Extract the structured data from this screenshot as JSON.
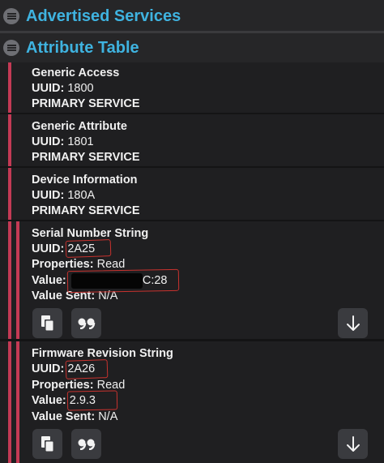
{
  "sections": {
    "advertised": "Advertised Services",
    "attribute_table": "Attribute Table"
  },
  "services": [
    {
      "name": "Generic Access",
      "uuid_label": "UUID:",
      "uuid": "1800",
      "type": "PRIMARY SERVICE"
    },
    {
      "name": "Generic Attribute",
      "uuid_label": "UUID:",
      "uuid": "1801",
      "type": "PRIMARY SERVICE"
    },
    {
      "name": "Device Information",
      "uuid_label": "UUID:",
      "uuid": "180A",
      "type": "PRIMARY SERVICE"
    }
  ],
  "characteristics": [
    {
      "name": "Serial Number String",
      "uuid_label": "UUID:",
      "uuid": "2A25",
      "properties_label": "Properties:",
      "properties": "Read",
      "value_label": "Value:",
      "value": ":1C:28",
      "sent_label": "Value Sent:",
      "sent": "N/A"
    },
    {
      "name": "Firmware Revision String",
      "uuid_label": "UUID:",
      "uuid": "2A26",
      "properties_label": "Properties:",
      "properties": "Read",
      "value_label": "Value:",
      "value": "2.9.3",
      "sent_label": "Value Sent:",
      "sent": "N/A"
    }
  ],
  "icons": {
    "copy": "copy-icon",
    "quote": "quote-icon",
    "download": "arrow-down-icon",
    "section": "list-icon"
  },
  "colors": {
    "accent": "#3fb3e0",
    "bar": "#c43a55",
    "annotation": "#c8322e"
  }
}
